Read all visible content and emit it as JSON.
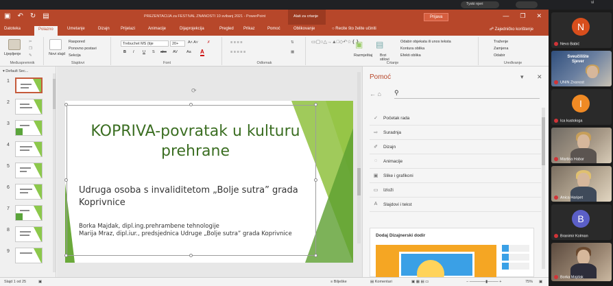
{
  "teams_top": {
    "user_label": "Tyski njeri",
    "tail_label": "vi"
  },
  "window": {
    "title": "PREZENTACIJA za FESTIVAL ZNANOSTI  10 svibanj 2021  -  PowerPoint",
    "context_tools": "Alati za crtanje",
    "signin": "Prijava",
    "window_buttons": [
      "—",
      "❐",
      "✕"
    ],
    "qat": [
      "▣",
      "↶",
      "↻",
      "▤"
    ]
  },
  "tabs": [
    {
      "label": "Datoteka"
    },
    {
      "label": "Polazno"
    },
    {
      "label": "Umetanje"
    },
    {
      "label": "Dizajn"
    },
    {
      "label": "Prijelazi"
    },
    {
      "label": "Animacije"
    },
    {
      "label": "Dijaprojekcija"
    },
    {
      "label": "Pregled"
    },
    {
      "label": "Prikaz"
    },
    {
      "label": "Pomoć"
    },
    {
      "label": "Oblikovanje"
    }
  ],
  "tell_me": "Recite što želite učiniti",
  "share": "Zajedničko korištenje",
  "ribbon": {
    "clipboard": {
      "paste": "Lijepljenje",
      "label": "Međuspremnik"
    },
    "slides": {
      "new": "Novi slajd",
      "layout": "Raspored",
      "reset": "Ponovno postavi",
      "section": "Sekcija",
      "label": "Slajdovi"
    },
    "font": {
      "name": "Trebuchet MS (tije",
      "size": "20+",
      "bold": "B",
      "italic": "I",
      "underline": "U",
      "shadow": "S",
      "strike": "abc",
      "spacing": "AV",
      "case": "Aa",
      "color": "A",
      "label": "Font"
    },
    "paragraph": {
      "label": "Odlomak"
    },
    "drawing": {
      "arrange": "Razmještaj",
      "quick": "Brzi stilovi",
      "fill": "Odabir objekata ili unos teksta",
      "outline": "Kontura oblika",
      "effects": "Efekti oblika",
      "label": "Crtanje"
    },
    "editing": {
      "find": "Traženje",
      "replace": "Zamjena",
      "select": "Odabir",
      "label": "Uređivanje"
    }
  },
  "thumbnails": {
    "section": "Default Sec...",
    "numbers": [
      "1",
      "2",
      "3",
      "4",
      "5",
      "6",
      "7",
      "8",
      "9"
    ]
  },
  "slide": {
    "title": "KOPRIVA-povratak u kulturu prehrane",
    "subtitle": "Udruga osoba s invaliditetom „Bolje sutra” grada Koprivnice",
    "authors": "Borka Majdak, dipl.ing.prehrambene tehnologije\nMarija Mraz, dipl.iur., predsjednica Udruge „Bolje sutra” grada Koprivnice"
  },
  "help": {
    "title": "Pomoć",
    "search_icon": "search-icon",
    "items": [
      {
        "icon": "✓",
        "label": "Početak rada"
      },
      {
        "icon": "⇨",
        "label": "Suradnja"
      },
      {
        "icon": "✐",
        "label": "Dizajn"
      },
      {
        "icon": "◌",
        "label": "Animacije"
      },
      {
        "icon": "▣",
        "label": "Slike i grafikoni"
      },
      {
        "icon": "▭",
        "label": "Izloži"
      },
      {
        "icon": "A",
        "label": "Slajdovi i tekst"
      }
    ],
    "card_title": "Dodaj Dizajnerski dodir"
  },
  "status": {
    "slide_count": "Slajd 1 od 25",
    "notes": "Bilješke",
    "comments": "Komentari",
    "zoom": "75%"
  },
  "participants": [
    {
      "name": "Nevo Babić",
      "type": "avatar",
      "initial": "N",
      "color": "#d84e1c"
    },
    {
      "name": "UNIN Znanost",
      "type": "video",
      "logo": "Sveučilište Sjever"
    },
    {
      "name": "Ica kustologa",
      "type": "avatar",
      "initial": "I",
      "color": "#f08a24"
    },
    {
      "name": "Martina Habar",
      "type": "video"
    },
    {
      "name": "Anica Haripet",
      "type": "video"
    },
    {
      "name": "Branimir Kolman",
      "type": "avatar",
      "initial": "B",
      "color": "#5b5fc7"
    },
    {
      "name": "Borka Majdak",
      "type": "video"
    }
  ]
}
